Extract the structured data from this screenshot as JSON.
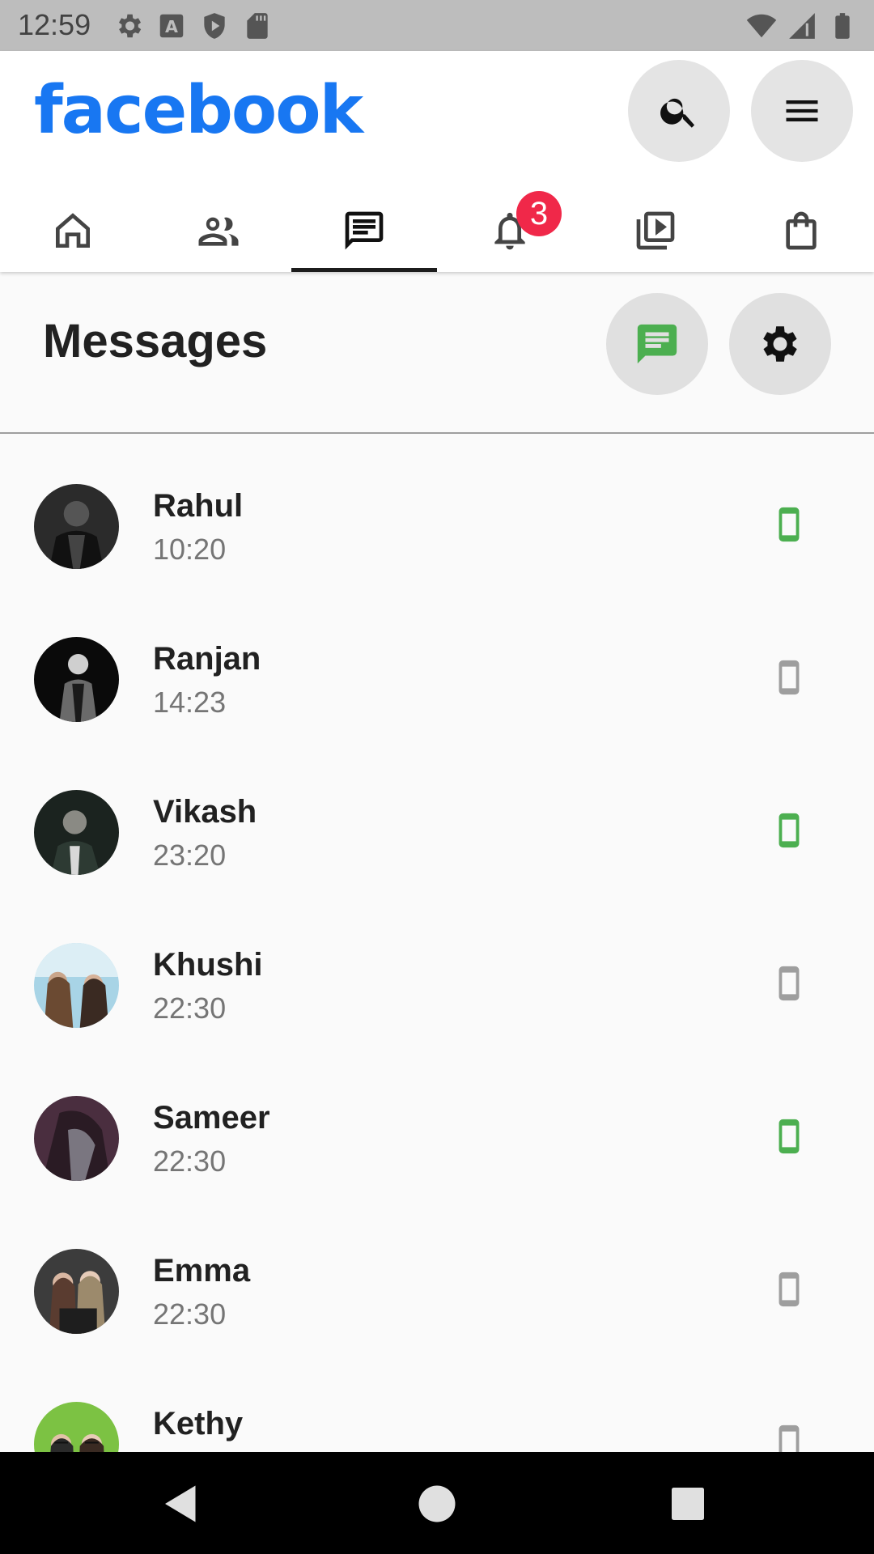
{
  "status_bar": {
    "time": "12:59"
  },
  "header": {
    "brand": "facebook",
    "brand_color": "#1877f2"
  },
  "nav_tabs": {
    "notification_count": "3",
    "active_tab": "messages"
  },
  "messages": {
    "title": "Messages",
    "accent_color": "#4caf50"
  },
  "contacts": [
    {
      "name": "Rahul",
      "time": "10:20",
      "device_active": true
    },
    {
      "name": "Ranjan",
      "time": "14:23",
      "device_active": false
    },
    {
      "name": "Vikash",
      "time": "23:20",
      "device_active": true
    },
    {
      "name": "Khushi",
      "time": "22:30",
      "device_active": false
    },
    {
      "name": "Sameer",
      "time": "22:30",
      "device_active": true
    },
    {
      "name": "Emma",
      "time": "22:30",
      "device_active": false
    },
    {
      "name": "Kethy",
      "time": "",
      "device_active": false
    }
  ],
  "icons": [
    "gear-icon",
    "a-icon",
    "shield-icon",
    "sd-card-icon",
    "wifi-icon",
    "signal-icon",
    "battery-icon",
    "search-icon",
    "menu-icon",
    "home-icon",
    "friends-icon",
    "messages-icon",
    "bell-icon",
    "video-icon",
    "shop-icon",
    "new-message-icon",
    "settings-icon",
    "phone-icon",
    "back-icon",
    "home-circle-icon",
    "recents-icon"
  ]
}
